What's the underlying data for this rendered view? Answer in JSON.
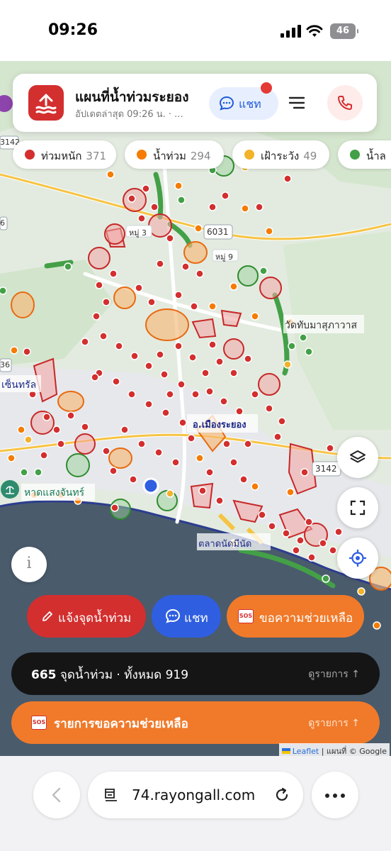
{
  "status_bar": {
    "time": "09:26",
    "battery": "46"
  },
  "header": {
    "title": "แผนที่น้ำท่วมระยอง",
    "subtitle": "อัปเดตล่าสุด 09:26 น. · ...",
    "chat_label": "แชท"
  },
  "legend": [
    {
      "label": "ท่วมหนัก",
      "count": "371",
      "color": "#d32f2f"
    },
    {
      "label": "น้ำท่วม",
      "count": "294",
      "color": "#f57c00"
    },
    {
      "label": "เฝ้าระวัง",
      "count": "49",
      "color": "#f2b32a"
    },
    {
      "label": "น้ำล",
      "count": "",
      "color": "#43a047"
    }
  ],
  "map_labels": {
    "district": "อ.เมืองระยอง",
    "beach": "หาดแสงจันทร์",
    "temple": "วัดทับมาสุภาวาส",
    "market": "ตลาดนัดมีนัด",
    "route_6031": "6031",
    "route_3142": "3142",
    "route_3142b": "3142",
    "village_9": "หมู่ 9",
    "village_3": "หมู่ 3",
    "left_36": "36",
    "left_6": "6",
    "left_3142": "3142",
    "west_area": "เซ็นทรัล"
  },
  "actions": {
    "report": "แจ้งจุดน้ำท่วม",
    "chat": "แชท",
    "sos_badge": "SOS",
    "help": "ขอความช่วยเหลือ"
  },
  "summary": {
    "flood_count": "665",
    "flood_text": "จุดน้ำท่วม · ทั้งหมด 919",
    "view_list": "ดูรายการ ↑"
  },
  "help_list": {
    "badge": "SOS",
    "title": "รายการขอความช่วยเหลือ",
    "view_list": "ดูรายการ ↑"
  },
  "attribution": {
    "leaflet": "Leaflet",
    "rest": "| แผนที่ © Google"
  },
  "browser": {
    "url": "74.rayongall.com"
  },
  "colors": {
    "heavy": "#d32f2f",
    "flood": "#f57c00",
    "watch": "#f2b32a",
    "normal": "#43a047",
    "chat_blue": "#2f5fe0",
    "sea": "#4a5b6c",
    "summary_bg": "#151515",
    "help_bg": "#f07a2a"
  }
}
